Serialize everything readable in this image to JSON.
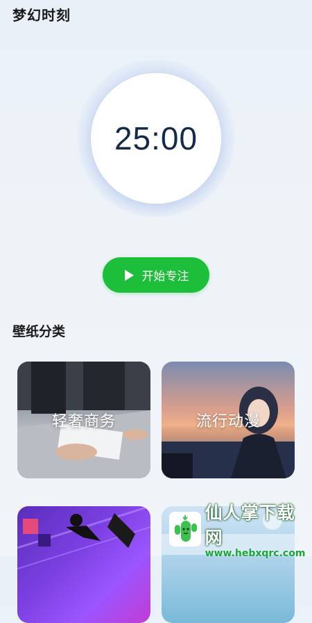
{
  "app": {
    "title": "梦幻时刻"
  },
  "timer": {
    "display": "25:00"
  },
  "start_button": {
    "label": "开始专注",
    "icon": "play-icon",
    "color": "#1dbf3a"
  },
  "wallpaper_section": {
    "title": "壁纸分类",
    "categories": [
      {
        "label": "轻奢商务"
      },
      {
        "label": "流行动漫"
      },
      {
        "label": ""
      },
      {
        "label": ""
      }
    ]
  },
  "watermark": {
    "name": "仙人掌下载网",
    "url": "www.hebxqrc.com"
  }
}
